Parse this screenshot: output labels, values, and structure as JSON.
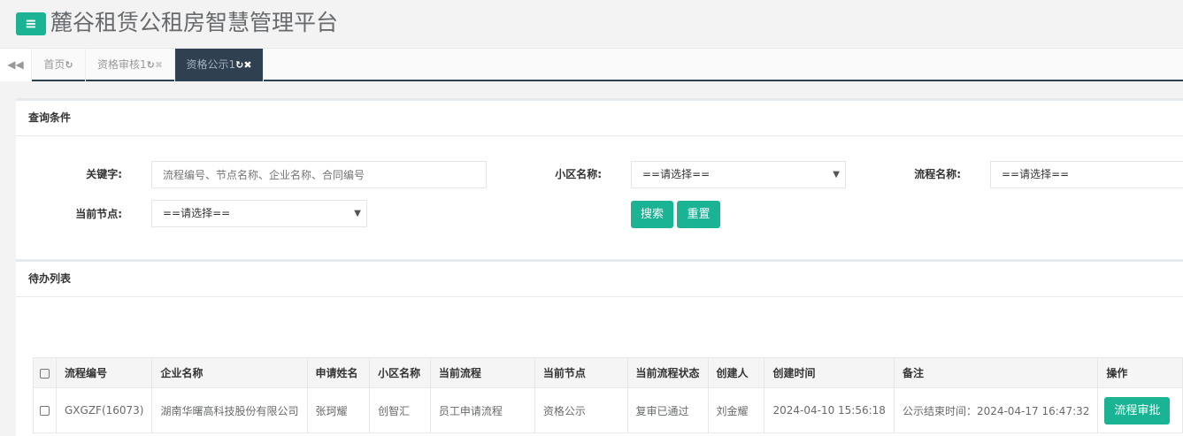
{
  "header": {
    "title": "麓谷租赁公租房智慧管理平台",
    "menu_icon": "≡"
  },
  "tabs": [
    {
      "label": "首页"
    },
    {
      "label": "资格审核1"
    },
    {
      "label": "资格公示1",
      "active": true
    }
  ],
  "query": {
    "title": "查询条件",
    "keyword_label": "关键字:",
    "keyword_placeholder": "流程编号、节点名称、企业名称、合同编号",
    "community_label": "小区名称:",
    "community_value": "==请选择==",
    "flow_label": "流程名称:",
    "flow_value": "==请选择==",
    "node_label": "当前节点:",
    "node_value": "==请选择==",
    "search": "搜索",
    "reset": "重置"
  },
  "list": {
    "title": "待办列表",
    "columns": [
      "流程编号",
      "企业名称",
      "申请姓名",
      "小区名称",
      "当前流程",
      "当前节点",
      "当前流程状态",
      "创建人",
      "创建时间",
      "备注",
      "操作"
    ],
    "rows": [
      {
        "cells": [
          "GXGZF(16073)",
          "湖南华曙高科技股份有限公司",
          "张珂耀",
          "创智汇",
          "员工申请流程",
          "资格公示",
          "复审已通过",
          "刘金耀",
          "2024-04-10 15:56:18",
          "公示结束时间：2024-04-17 16:47:32"
        ],
        "action": "流程审批"
      }
    ]
  },
  "colors": {
    "accent": "#1ab394",
    "dark": "#2f4050"
  }
}
